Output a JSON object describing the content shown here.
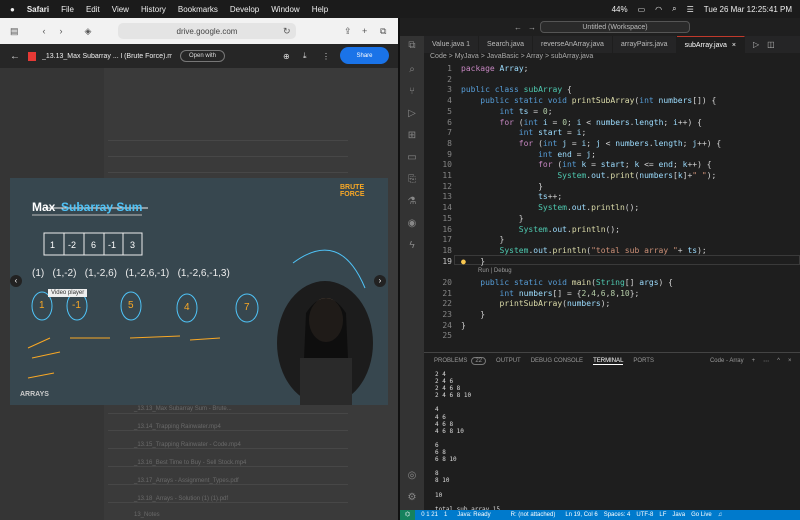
{
  "menubar": {
    "apple": "",
    "app": "Safari",
    "items": [
      "File",
      "Edit",
      "View",
      "History",
      "Bookmarks",
      "Develop",
      "Window",
      "Help"
    ],
    "battery": "44%",
    "datetime": "Tue 26 Mar  12:25:41 PM"
  },
  "safari": {
    "address": "drive.google.com",
    "file_title": "_13.13_Max Subarray ... l (Brute Force).mp4",
    "open_with": "Open with",
    "share": "Share",
    "video": {
      "title_part1": "Max ",
      "title_part2": "Subarray Sum",
      "tag": "BRUTE FORCE",
      "array": [
        "1",
        "-2",
        "6",
        "-1",
        "3"
      ],
      "subarrays": "(1)   (1,-2)   (1,-2,6)   (1,-2,6,-1)   (1,-2,6,-1,3)",
      "sums": [
        "1",
        "-1",
        "5",
        "4",
        "7"
      ],
      "tooltip": "Video player",
      "footer": "ARRAYS"
    },
    "drive_rows": [
      "_13.13_Max Subarray Sum - Brute...",
      "_13.14_Trapping Rainwater.mp4",
      "_13.15_Trapping Rainwater - Code.mp4",
      "_13.16_Best Time to Buy - Sell Stock.mp4",
      "_13.17_Arrays - Assignment_Types.pdf",
      "_13.18_Arrays - Solution (1) (1).pdf",
      "13_Notes"
    ]
  },
  "vscode": {
    "title": "Untitled (Workspace)",
    "tabs": [
      "Value.java 1",
      "Search.java",
      "reverseAnArray.java",
      "arrayPairs.java",
      "subArray.java"
    ],
    "breadcrumb": "Code  >  MyJava  >  JavaBasic  >  Array  >  subArray.java",
    "line_numbers": [
      "1",
      "2",
      "3",
      "4",
      "5",
      "6",
      "7",
      "8",
      "9",
      "10",
      "11",
      "12",
      "13",
      "14",
      "15",
      "16",
      "17",
      "18",
      "19",
      "20",
      "21",
      "22",
      "23",
      "24",
      "25"
    ],
    "codelens": "Run | Debug",
    "panel_tabs": [
      "PROBLEMS",
      "22",
      "OUTPUT",
      "DEBUG CONSOLE",
      "TERMINAL",
      "PORTS"
    ],
    "panel_right": "Code - Array",
    "terminal": [
      "2 4",
      "2 4 6",
      "2 4 6 8",
      "2 4 6 8 10",
      "",
      "4",
      "4 6",
      "4 6 8",
      "4 6 8 10",
      "",
      "6",
      "6 8",
      "6 8 10",
      "",
      "8",
      "8 10",
      "",
      "10",
      "",
      "total sub array 15",
      "ravijaiswal@Ravis-MacBook-Air Array %"
    ],
    "status": {
      "branch": "0 1 21",
      "warn": "1",
      "java": "Java: Ready",
      "attach": "R: (not attached)",
      "pos": "Ln 19, Col 6",
      "spaces": "Spaces: 4",
      "enc": "UTF-8",
      "eol": "LF",
      "lang": "Java",
      "golive": "Go Live"
    }
  }
}
